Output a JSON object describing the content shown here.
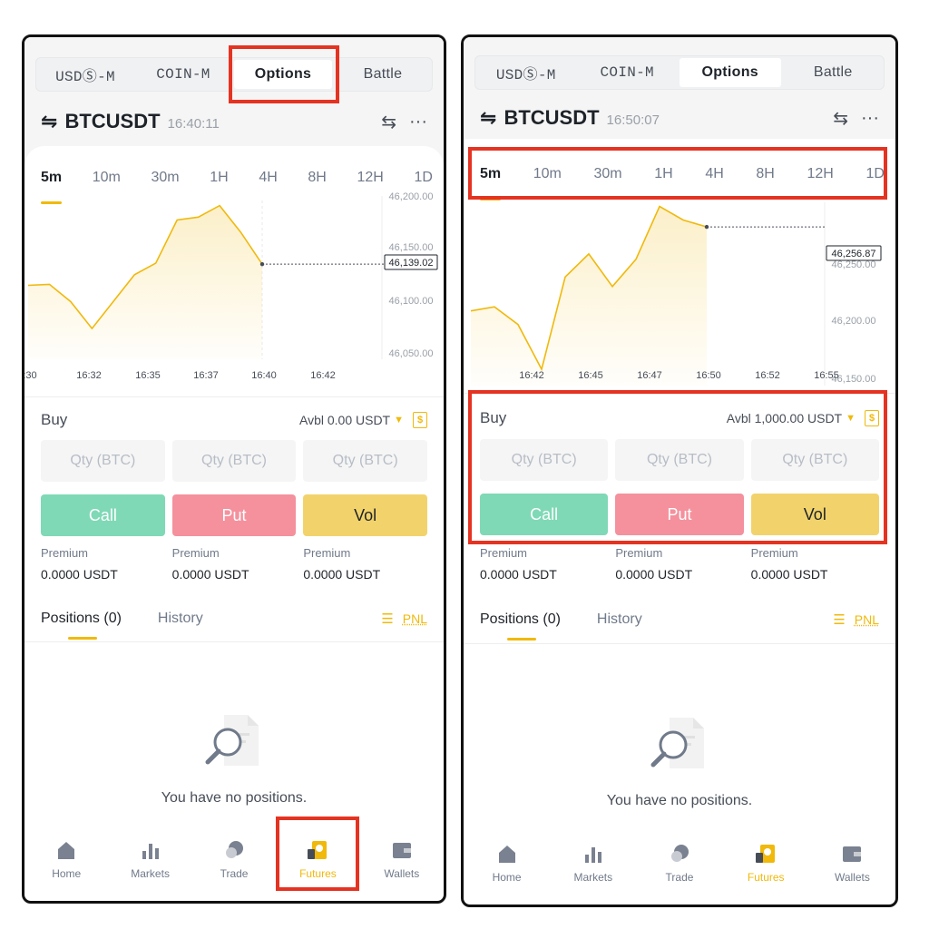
{
  "left": {
    "tabs": [
      "USDⓈ-M",
      "COIN-M",
      "Options",
      "Battle"
    ],
    "symbol": "BTCUSDT",
    "time": "16:40:11",
    "intervals": [
      "5m",
      "10m",
      "30m",
      "1H",
      "4H",
      "8H",
      "12H",
      "1D"
    ],
    "price_axis": [
      "46,200.00",
      "46,150.00",
      "46,100.00",
      "46,050.00"
    ],
    "current_price": "46,139.02",
    "time_axis": [
      ":30",
      "16:32",
      "16:35",
      "16:37",
      "16:40",
      "16:42"
    ],
    "buy_label": "Buy",
    "avbl": "Avbl 0.00 USDT",
    "qty_placeholder": "Qty (BTC)",
    "buttons": {
      "call": "Call",
      "put": "Put",
      "vol": "Vol"
    },
    "premium_label": "Premium",
    "premium_value": "0.0000 USDT",
    "positions_tab": "Positions (0)",
    "history_tab": "History",
    "pnl": "PNL",
    "empty_text": "You have no positions.",
    "nav": [
      "Home",
      "Markets",
      "Trade",
      "Futures",
      "Wallets"
    ],
    "chart_data": {
      "type": "line",
      "x": [
        "16:29",
        "16:30",
        "16:31",
        "16:32",
        "16:33",
        "16:34",
        "16:35",
        "16:36",
        "16:37",
        "16:38",
        "16:39",
        "16:40"
      ],
      "values": [
        46117,
        46118,
        46100,
        46072,
        46100,
        46128,
        46140,
        46185,
        46188,
        46200,
        46172,
        46139.02
      ],
      "ylim": [
        46040,
        46210
      ]
    }
  },
  "right": {
    "tabs": [
      "USDⓈ-M",
      "COIN-M",
      "Options",
      "Battle"
    ],
    "symbol": "BTCUSDT",
    "time": "16:50:07",
    "intervals": [
      "5m",
      "10m",
      "30m",
      "1H",
      "4H",
      "8H",
      "12H",
      "1D"
    ],
    "price_axis": [
      "46,250.00",
      "46,200.00",
      "46,150.00"
    ],
    "current_price": "46,256.87",
    "time_axis": [
      "16:42",
      "16:45",
      "16:47",
      "16:50",
      "16:52",
      "16:55"
    ],
    "buy_label": "Buy",
    "avbl": "Avbl 1,000.00 USDT",
    "qty_placeholder": "Qty (BTC)",
    "buttons": {
      "call": "Call",
      "put": "Put",
      "vol": "Vol"
    },
    "premium_label": "Premium",
    "premium_value": "0.0000 USDT",
    "positions_tab": "Positions (0)",
    "history_tab": "History",
    "pnl": "PNL",
    "empty_text": "You have no positions.",
    "nav": [
      "Home",
      "Markets",
      "Trade",
      "Futures",
      "Wallets"
    ],
    "chart_data": {
      "type": "line",
      "x": [
        "16:39",
        "16:40",
        "16:41",
        "16:42",
        "16:43",
        "16:44",
        "16:45",
        "16:46",
        "16:47",
        "16:48",
        "16:49",
        "16:50"
      ],
      "values": [
        46195,
        46198,
        46185,
        46152,
        46220,
        46237,
        46213,
        46233,
        46272,
        46262,
        46256.87
      ],
      "ylim": [
        46140,
        46275
      ]
    }
  },
  "colors": {
    "accent": "#f0b90b",
    "call": "#7fd9b6",
    "put": "#f4919d",
    "vol": "#f2d36b",
    "highlight": "#e53322"
  }
}
